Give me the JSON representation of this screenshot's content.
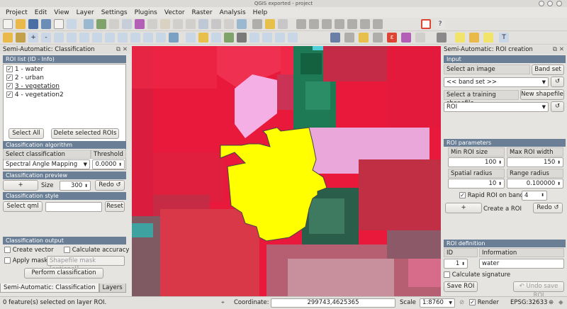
{
  "window": {
    "title": "QGIS exported - project"
  },
  "menu": [
    "Project",
    "Edit",
    "View",
    "Layer",
    "Settings",
    "Plugins",
    "Vector",
    "Raster",
    "Analysis",
    "Help"
  ],
  "left_panel": {
    "title": "Semi-Automatic: Classification",
    "roi_list_header": "ROI list (ID - Info)",
    "rois": [
      "1 - water",
      "2 - urban",
      "3 - vegetation",
      "4 - vegetation2"
    ],
    "select_all": "Select All",
    "delete_selected": "Delete selected ROIs",
    "algorithm_section": "Classification algorithm",
    "select_algorithm_label": "Select classification algorithm",
    "threshold_label": "Threshold",
    "algorithm_value": "Spectral Angle Mapping",
    "threshold_value": "0.0000",
    "preview_section": "Classification preview",
    "plus": "+",
    "size_label": "Size",
    "size_value": "300",
    "redo": "Redo",
    "style_section": "Classification style",
    "select_qml": "Select qml",
    "reset": "Reset",
    "output_section": "Classification output",
    "create_vector": "Create vector",
    "calculate_accuracy": "Calculate accuracy",
    "apply_mask": "Apply mask",
    "mask_placeholder": "Shapefile mask [optional]",
    "perform_classification": "Perform classification",
    "tabs": [
      "Semi-Automatic: Classification",
      "Layers"
    ]
  },
  "right_panel": {
    "title": "Semi-Automatic: ROI creation",
    "input_section": "Input",
    "select_image": "Select an image",
    "band_set": "Band set",
    "band_set_value": "<< band set >>",
    "select_training": "Select a training shapefile",
    "new_shapefile": "New shapefile",
    "shapefile_value": "ROI",
    "roi_params_section": "ROI parameters",
    "min_roi_label": "Min ROI size",
    "max_roi_label": "Max ROI width",
    "min_roi_value": "100",
    "max_roi_value": "150",
    "spatial_radius_label": "Spatial radius",
    "range_radius_label": "Range radius",
    "spatial_radius_value": "10",
    "range_radius_value": "0.100000",
    "rapid_roi_label": "Rapid ROI on band",
    "rapid_roi_band": "4",
    "plus": "+",
    "create_roi": "Create a ROI",
    "redo": "Redo",
    "roi_def_section": "ROI definition",
    "id_label": "ID",
    "info_label": "Information",
    "id_value": "1",
    "info_value": "water",
    "calculate_signature": "Calculate signature",
    "save_roi": "Save ROI",
    "undo_save_roi": "Undo save ROI"
  },
  "statusbar": {
    "selected_text": "0 feature(s) selected on layer ROI.",
    "coordinate_label": "Coordinate:",
    "coordinate_value": "299743,4625365",
    "scale_label": "Scale",
    "scale_value": "1:8760",
    "render_label": "Render",
    "epsg": "EPSG:32633"
  },
  "colors": {
    "accent": "#6a7f96",
    "map_red": "#e8193b",
    "roi_yellow": "#ffff00",
    "roi_pink": "#f4b0e4",
    "veg_green": "#1e7a55"
  }
}
